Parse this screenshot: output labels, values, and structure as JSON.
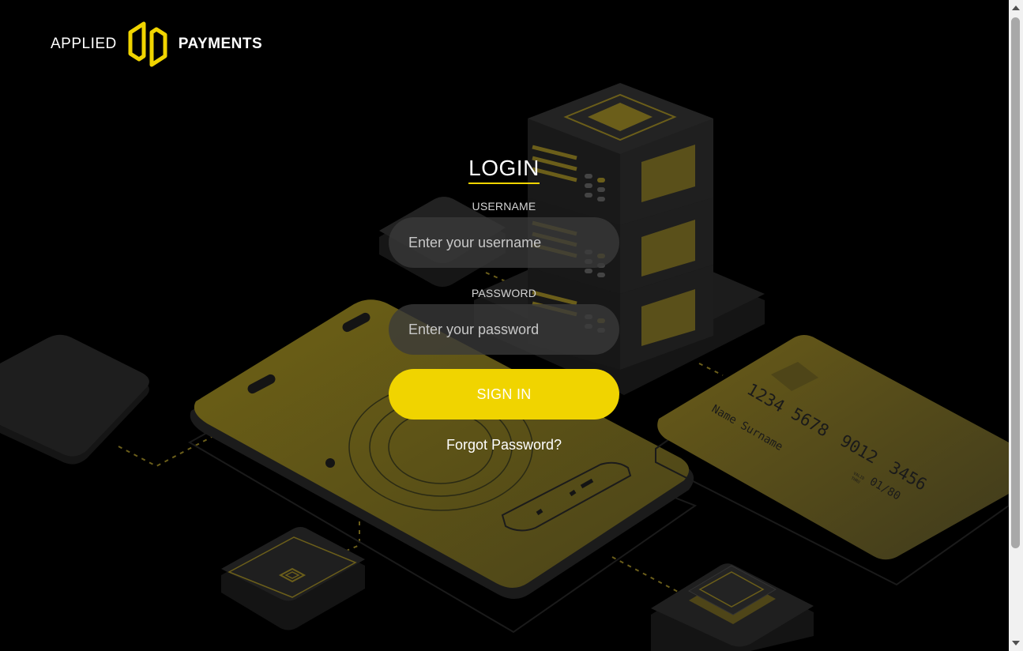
{
  "brand": {
    "left_word": "APPLIED",
    "right_word": "PAYMENTS",
    "logo_icon": "applied-payments-logo-mark",
    "accent_color": "#f0d400"
  },
  "login": {
    "title": "LOGIN",
    "username_label": "USERNAME",
    "username_placeholder": "Enter your username",
    "password_label": "PASSWORD",
    "password_placeholder": "Enter your password",
    "signin_label": "SIGN IN",
    "forgot_label": "Forgot Password?"
  },
  "card": {
    "number_groups": [
      "1234",
      "5678",
      "9012",
      "3456"
    ],
    "holder": "Name Surname",
    "valid_label_1": "VALID",
    "valid_label_2": "THRU",
    "expiry": "01/80"
  }
}
